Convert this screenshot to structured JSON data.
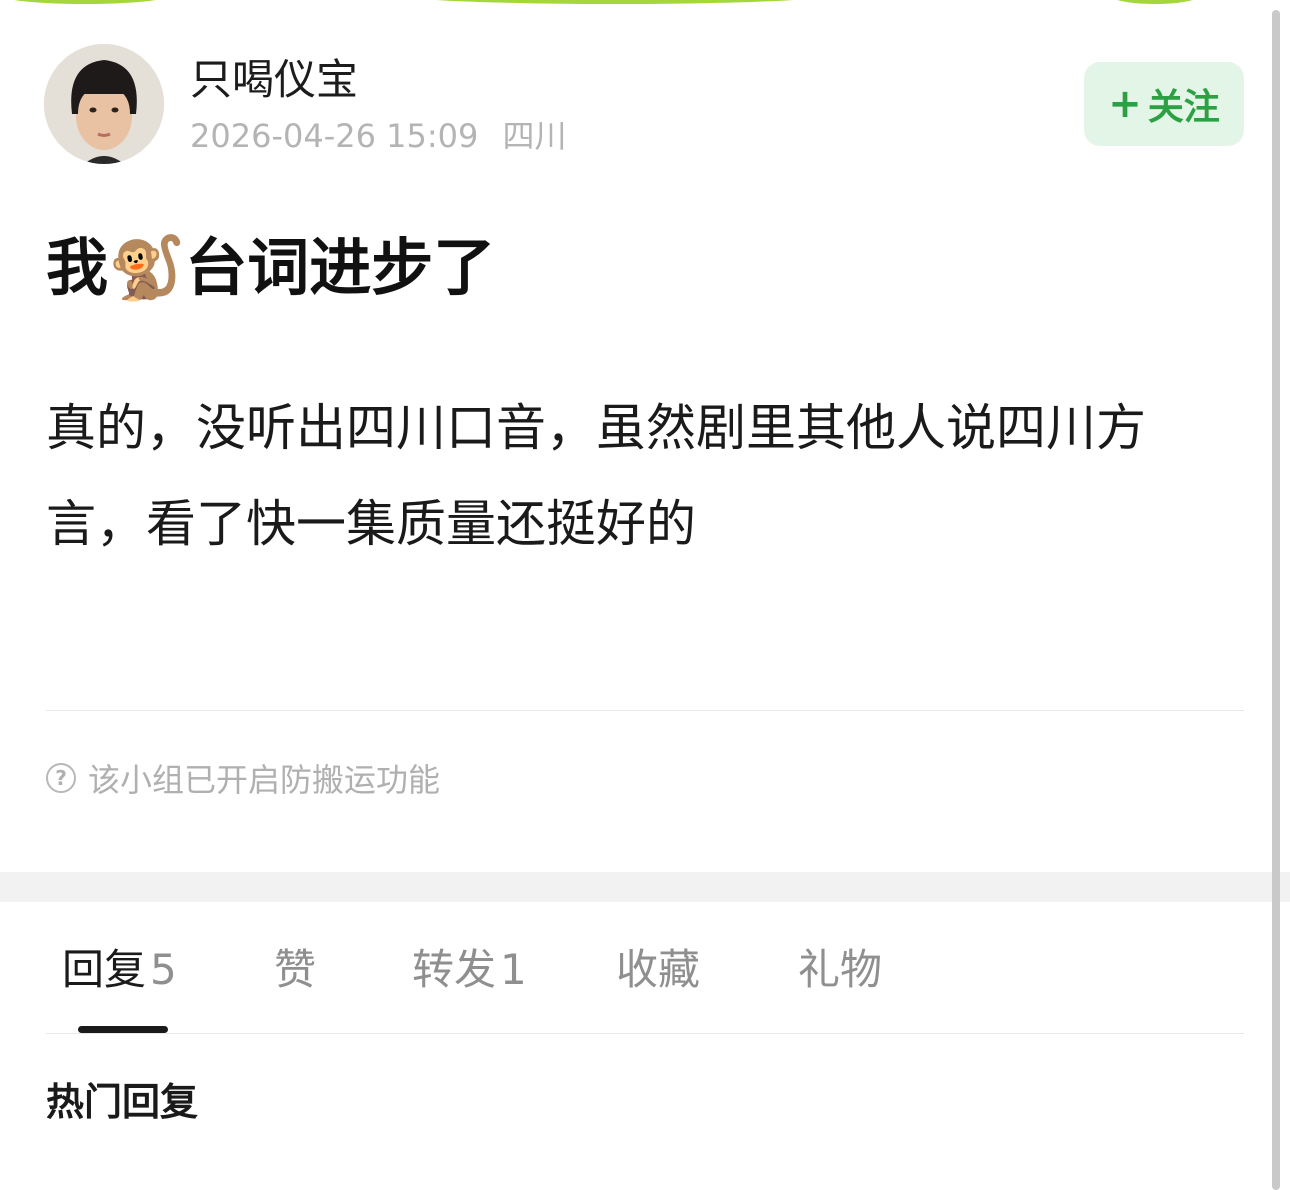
{
  "post": {
    "author_name": "只喝仪宝",
    "timestamp": "2026-04-26 15:09",
    "location": "四川",
    "follow_label": "关注",
    "title": "我🐒台词进步了",
    "body": "真的，没听出四川口音，虽然剧里其他人说四川方言，看了快一集质量还挺好的",
    "anti_repost_note": "该小组已开启防搬运功能"
  },
  "tabs": [
    {
      "label": "回复",
      "count": "5",
      "active": true
    },
    {
      "label": "赞",
      "count": ""
    },
    {
      "label": "转发",
      "count": "1"
    },
    {
      "label": "收藏",
      "count": ""
    },
    {
      "label": "礼物",
      "count": ""
    }
  ],
  "replies": {
    "heading": "热门回复"
  },
  "colors": {
    "accent_green": "#2ca143",
    "follow_bg": "#e3f5e6",
    "meta_gray": "#b4b4b4",
    "top_accent": "#a5d63b"
  },
  "icons": {
    "follow": "plus-icon",
    "note": "help-circle-icon"
  }
}
